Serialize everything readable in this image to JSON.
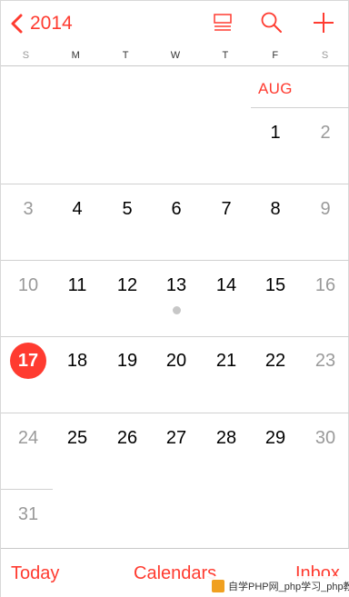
{
  "header": {
    "back_label": "2014",
    "icons": [
      "list-view-icon",
      "search-icon",
      "add-icon"
    ]
  },
  "weekdays": [
    "S",
    "M",
    "T",
    "W",
    "T",
    "F",
    "S"
  ],
  "month": {
    "label": "AUG"
  },
  "days": {
    "d1": "1",
    "d2": "2",
    "d3": "3",
    "d4": "4",
    "d5": "5",
    "d6": "6",
    "d7": "7",
    "d8": "8",
    "d9": "9",
    "d10": "10",
    "d11": "11",
    "d12": "12",
    "d13": "13",
    "d14": "14",
    "d15": "15",
    "d16": "16",
    "d17": "17",
    "d18": "18",
    "d19": "19",
    "d20": "20",
    "d21": "21",
    "d22": "22",
    "d23": "23",
    "d24": "24",
    "d25": "25",
    "d26": "26",
    "d27": "27",
    "d28": "28",
    "d29": "29",
    "d30": "30",
    "d31": "31"
  },
  "today": "17",
  "event_days": [
    "13"
  ],
  "toolbar": {
    "today": "Today",
    "calendars": "Calendars",
    "inbox": "Inbox"
  },
  "watermark": {
    "text": "自学PHP网_php学习_php教程"
  },
  "colors": {
    "accent": "#ff3b30",
    "weekend_text": "#9a9a9a",
    "event_dot": "#c7c7c7"
  }
}
